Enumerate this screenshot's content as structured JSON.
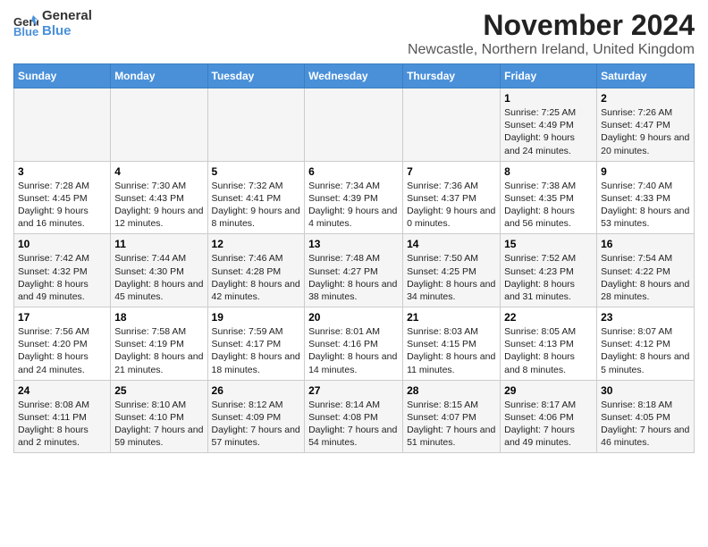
{
  "logo": {
    "text1": "General",
    "text2": "Blue"
  },
  "title": "November 2024",
  "subtitle": "Newcastle, Northern Ireland, United Kingdom",
  "days_header": [
    "Sunday",
    "Monday",
    "Tuesday",
    "Wednesday",
    "Thursday",
    "Friday",
    "Saturday"
  ],
  "weeks": [
    {
      "cells": [
        {
          "empty": true
        },
        {
          "empty": true
        },
        {
          "empty": true
        },
        {
          "empty": true
        },
        {
          "empty": true
        },
        {
          "day": "1",
          "sunrise": "Sunrise: 7:25 AM",
          "sunset": "Sunset: 4:49 PM",
          "daylight": "Daylight: 9 hours and 24 minutes."
        },
        {
          "day": "2",
          "sunrise": "Sunrise: 7:26 AM",
          "sunset": "Sunset: 4:47 PM",
          "daylight": "Daylight: 9 hours and 20 minutes."
        }
      ]
    },
    {
      "cells": [
        {
          "day": "3",
          "sunrise": "Sunrise: 7:28 AM",
          "sunset": "Sunset: 4:45 PM",
          "daylight": "Daylight: 9 hours and 16 minutes."
        },
        {
          "day": "4",
          "sunrise": "Sunrise: 7:30 AM",
          "sunset": "Sunset: 4:43 PM",
          "daylight": "Daylight: 9 hours and 12 minutes."
        },
        {
          "day": "5",
          "sunrise": "Sunrise: 7:32 AM",
          "sunset": "Sunset: 4:41 PM",
          "daylight": "Daylight: 9 hours and 8 minutes."
        },
        {
          "day": "6",
          "sunrise": "Sunrise: 7:34 AM",
          "sunset": "Sunset: 4:39 PM",
          "daylight": "Daylight: 9 hours and 4 minutes."
        },
        {
          "day": "7",
          "sunrise": "Sunrise: 7:36 AM",
          "sunset": "Sunset: 4:37 PM",
          "daylight": "Daylight: 9 hours and 0 minutes."
        },
        {
          "day": "8",
          "sunrise": "Sunrise: 7:38 AM",
          "sunset": "Sunset: 4:35 PM",
          "daylight": "Daylight: 8 hours and 56 minutes."
        },
        {
          "day": "9",
          "sunrise": "Sunrise: 7:40 AM",
          "sunset": "Sunset: 4:33 PM",
          "daylight": "Daylight: 8 hours and 53 minutes."
        }
      ]
    },
    {
      "cells": [
        {
          "day": "10",
          "sunrise": "Sunrise: 7:42 AM",
          "sunset": "Sunset: 4:32 PM",
          "daylight": "Daylight: 8 hours and 49 minutes."
        },
        {
          "day": "11",
          "sunrise": "Sunrise: 7:44 AM",
          "sunset": "Sunset: 4:30 PM",
          "daylight": "Daylight: 8 hours and 45 minutes."
        },
        {
          "day": "12",
          "sunrise": "Sunrise: 7:46 AM",
          "sunset": "Sunset: 4:28 PM",
          "daylight": "Daylight: 8 hours and 42 minutes."
        },
        {
          "day": "13",
          "sunrise": "Sunrise: 7:48 AM",
          "sunset": "Sunset: 4:27 PM",
          "daylight": "Daylight: 8 hours and 38 minutes."
        },
        {
          "day": "14",
          "sunrise": "Sunrise: 7:50 AM",
          "sunset": "Sunset: 4:25 PM",
          "daylight": "Daylight: 8 hours and 34 minutes."
        },
        {
          "day": "15",
          "sunrise": "Sunrise: 7:52 AM",
          "sunset": "Sunset: 4:23 PM",
          "daylight": "Daylight: 8 hours and 31 minutes."
        },
        {
          "day": "16",
          "sunrise": "Sunrise: 7:54 AM",
          "sunset": "Sunset: 4:22 PM",
          "daylight": "Daylight: 8 hours and 28 minutes."
        }
      ]
    },
    {
      "cells": [
        {
          "day": "17",
          "sunrise": "Sunrise: 7:56 AM",
          "sunset": "Sunset: 4:20 PM",
          "daylight": "Daylight: 8 hours and 24 minutes."
        },
        {
          "day": "18",
          "sunrise": "Sunrise: 7:58 AM",
          "sunset": "Sunset: 4:19 PM",
          "daylight": "Daylight: 8 hours and 21 minutes."
        },
        {
          "day": "19",
          "sunrise": "Sunrise: 7:59 AM",
          "sunset": "Sunset: 4:17 PM",
          "daylight": "Daylight: 8 hours and 18 minutes."
        },
        {
          "day": "20",
          "sunrise": "Sunrise: 8:01 AM",
          "sunset": "Sunset: 4:16 PM",
          "daylight": "Daylight: 8 hours and 14 minutes."
        },
        {
          "day": "21",
          "sunrise": "Sunrise: 8:03 AM",
          "sunset": "Sunset: 4:15 PM",
          "daylight": "Daylight: 8 hours and 11 minutes."
        },
        {
          "day": "22",
          "sunrise": "Sunrise: 8:05 AM",
          "sunset": "Sunset: 4:13 PM",
          "daylight": "Daylight: 8 hours and 8 minutes."
        },
        {
          "day": "23",
          "sunrise": "Sunrise: 8:07 AM",
          "sunset": "Sunset: 4:12 PM",
          "daylight": "Daylight: 8 hours and 5 minutes."
        }
      ]
    },
    {
      "cells": [
        {
          "day": "24",
          "sunrise": "Sunrise: 8:08 AM",
          "sunset": "Sunset: 4:11 PM",
          "daylight": "Daylight: 8 hours and 2 minutes."
        },
        {
          "day": "25",
          "sunrise": "Sunrise: 8:10 AM",
          "sunset": "Sunset: 4:10 PM",
          "daylight": "Daylight: 7 hours and 59 minutes."
        },
        {
          "day": "26",
          "sunrise": "Sunrise: 8:12 AM",
          "sunset": "Sunset: 4:09 PM",
          "daylight": "Daylight: 7 hours and 57 minutes."
        },
        {
          "day": "27",
          "sunrise": "Sunrise: 8:14 AM",
          "sunset": "Sunset: 4:08 PM",
          "daylight": "Daylight: 7 hours and 54 minutes."
        },
        {
          "day": "28",
          "sunrise": "Sunrise: 8:15 AM",
          "sunset": "Sunset: 4:07 PM",
          "daylight": "Daylight: 7 hours and 51 minutes."
        },
        {
          "day": "29",
          "sunrise": "Sunrise: 8:17 AM",
          "sunset": "Sunset: 4:06 PM",
          "daylight": "Daylight: 7 hours and 49 minutes."
        },
        {
          "day": "30",
          "sunrise": "Sunrise: 8:18 AM",
          "sunset": "Sunset: 4:05 PM",
          "daylight": "Daylight: 7 hours and 46 minutes."
        }
      ]
    }
  ]
}
